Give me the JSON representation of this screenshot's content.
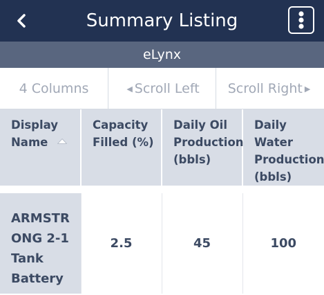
{
  "header": {
    "title": "Summary Listing",
    "back_icon": "chevron-left-icon",
    "menu_icon": "kebab-menu-icon"
  },
  "subheader": {
    "label": "eLynx"
  },
  "controls": {
    "columns_label": "4 Columns",
    "scroll_left_label": "Scroll Left",
    "scroll_right_label": "Scroll Right"
  },
  "table": {
    "columns": [
      [
        "Display",
        "Name"
      ],
      [
        "Capacity",
        "Filled (%)"
      ],
      [
        "Daily Oil",
        "Production",
        "(bbls)"
      ],
      [
        "Daily",
        "Water",
        "Production",
        "(bbls)"
      ]
    ],
    "sorted_column": 0,
    "rows": [
      {
        "name_lines": [
          "ARMSTR",
          "ONG 2-1",
          "Tank",
          "Battery"
        ],
        "capacity": "2.5",
        "oil": "45",
        "water": "100"
      }
    ]
  },
  "colors": {
    "header_bg": "#223252",
    "subheader_bg": "#59667f",
    "cell_bg": "#d8dde6",
    "text": "#3c4a63",
    "muted": "#a1a8b6"
  }
}
